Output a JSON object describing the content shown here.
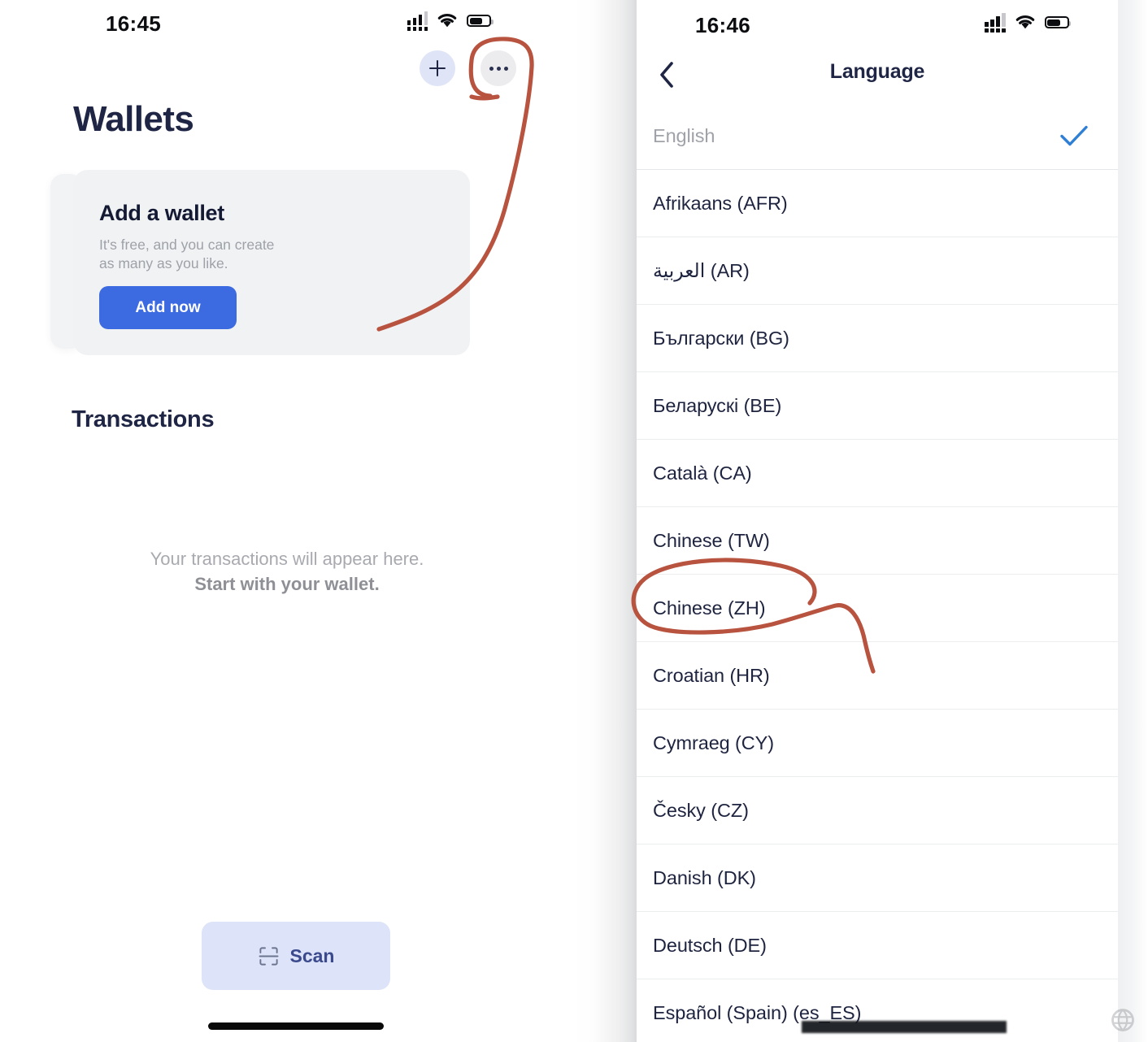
{
  "left_phone": {
    "status_bar": {
      "time": "16:45",
      "signal_icon": "cellular-signal-icon",
      "wifi_icon": "wifi-icon",
      "battery_icon": "battery-icon",
      "battery_level_pct": 62
    },
    "header": {
      "add_button_icon": "plus-icon",
      "more_button_icon": "ellipsis-icon",
      "title": "Wallets"
    },
    "wallet_card": {
      "title": "Add a wallet",
      "subtitle": "It's free, and you can create as many as you like.",
      "button_label": "Add now",
      "button_color": "#3b6ae1",
      "card_bg": "#f1f2f4"
    },
    "transactions": {
      "title": "Transactions",
      "empty_line1": "Your transactions will appear here.",
      "empty_line2": "Start with your wallet."
    },
    "scan_button": {
      "label": "Scan",
      "icon": "scan-frame-icon",
      "bg": "#dde3f8",
      "text_color": "#3b4a8c"
    }
  },
  "right_phone": {
    "status_bar": {
      "time": "16:46",
      "signal_icon": "cellular-signal-icon",
      "wifi_icon": "wifi-icon",
      "battery_icon": "battery-icon",
      "battery_level_pct": 62
    },
    "nav": {
      "back_icon": "chevron-left-icon",
      "title": "Language"
    },
    "selected_language": "English",
    "check_icon": "checkmark-icon",
    "check_color": "#2f7fd4",
    "languages": [
      {
        "name": "English",
        "selected": true
      },
      {
        "name": "Afrikaans (AFR)",
        "selected": false
      },
      {
        "name": "العربية (AR)",
        "selected": false
      },
      {
        "name": "Български (BG)",
        "selected": false
      },
      {
        "name": "Беларускі (BE)",
        "selected": false
      },
      {
        "name": "Català (CA)",
        "selected": false
      },
      {
        "name": "Chinese (TW)",
        "selected": false
      },
      {
        "name": "Chinese (ZH)",
        "selected": false
      },
      {
        "name": "Croatian (HR)",
        "selected": false
      },
      {
        "name": "Cymraeg (CY)",
        "selected": false
      },
      {
        "name": "Česky (CZ)",
        "selected": false
      },
      {
        "name": "Danish (DK)",
        "selected": false
      },
      {
        "name": "Deutsch (DE)",
        "selected": false
      },
      {
        "name": "Español (Spain) (es_ES)",
        "selected": false
      }
    ]
  },
  "annotations": {
    "color": "#b8533f",
    "items": [
      {
        "name": "circle-around-more-button",
        "target": "ellipsis-icon"
      },
      {
        "name": "circle-around-chinese-zh",
        "target": "Chinese (ZH)"
      }
    ]
  }
}
